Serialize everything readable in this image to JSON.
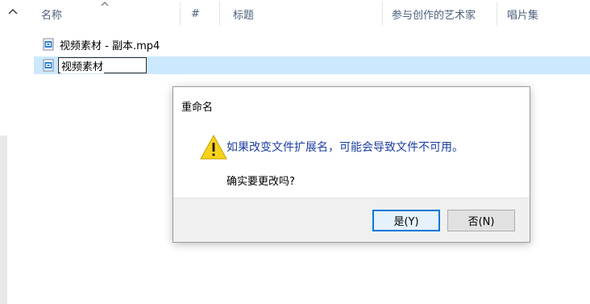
{
  "columns": {
    "name": "名称",
    "number": "#",
    "title": "标题",
    "artists": "参与创作的艺术家",
    "album": "唱片集"
  },
  "files": [
    {
      "name": "视频素材 - 副本.mp4",
      "icon": "video-file-icon"
    },
    {
      "name": "视频素材",
      "icon": "video-file-icon",
      "editing": true
    }
  ],
  "dialog": {
    "title": "重命名",
    "message": "如果改变文件扩展名，可能会导致文件不可用。",
    "question": "确实要更改吗?",
    "yes_label": "是(Y)",
    "no_label": "否(N)",
    "icon": "warning-icon"
  },
  "colors": {
    "selection": "#cce8ff",
    "header_text": "#4c607a",
    "message_text": "#1d3fa0",
    "accent": "#0078d7"
  }
}
